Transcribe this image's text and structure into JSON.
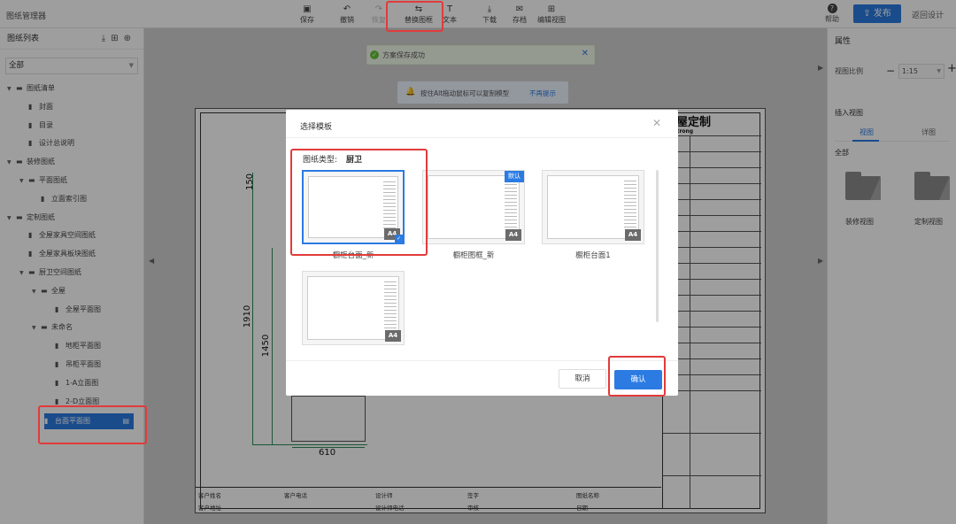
{
  "app": {
    "title": "图纸管理器"
  },
  "toolbar": {
    "items": [
      {
        "label": "保存",
        "icon": "save-icon"
      },
      {
        "label": "撤销",
        "icon": "undo-icon"
      },
      {
        "label": "恢复",
        "icon": "redo-icon"
      },
      {
        "label": "替换图框",
        "icon": "swap-icon"
      },
      {
        "label": "文本",
        "icon": "text-icon"
      },
      {
        "label": "下载",
        "icon": "download-icon"
      },
      {
        "label": "存档",
        "icon": "archive-icon"
      },
      {
        "label": "编辑视图",
        "icon": "edit-view-icon"
      }
    ],
    "help": "帮助",
    "publish": "发布",
    "back": "返回设计"
  },
  "left_panel": {
    "title": "图纸列表",
    "filter": "全部",
    "tree": [
      {
        "label": "图纸清单",
        "level": 0,
        "type": "group"
      },
      {
        "label": "封面",
        "level": 1,
        "type": "file"
      },
      {
        "label": "目录",
        "level": 1,
        "type": "file"
      },
      {
        "label": "设计总说明",
        "level": 1,
        "type": "file"
      },
      {
        "label": "装修图纸",
        "level": 0,
        "type": "group"
      },
      {
        "label": "平面图纸",
        "level": 1,
        "type": "group"
      },
      {
        "label": "立面索引图",
        "level": 2,
        "type": "file"
      },
      {
        "label": "定制图纸",
        "level": 0,
        "type": "group"
      },
      {
        "label": "全屋家具空间图纸",
        "level": 1,
        "type": "file"
      },
      {
        "label": "全屋家具板块图纸",
        "level": 1,
        "type": "file"
      },
      {
        "label": "厨卫空间图纸",
        "level": 1,
        "type": "group"
      },
      {
        "label": "全屋",
        "level": 2,
        "type": "group"
      },
      {
        "label": "全屋平面图",
        "level": 3,
        "type": "file"
      },
      {
        "label": "未命名",
        "level": 2,
        "type": "group"
      },
      {
        "label": "地柜平面图",
        "level": 3,
        "type": "file"
      },
      {
        "label": "吊柜平面图",
        "level": 3,
        "type": "file"
      },
      {
        "label": "1-A立面图",
        "level": 3,
        "type": "file"
      },
      {
        "label": "2-D立面图",
        "level": 3,
        "type": "file"
      },
      {
        "label": "台面平面图",
        "level": 2,
        "type": "file",
        "selected": true
      }
    ]
  },
  "right_panel": {
    "title": "属性",
    "scale_label": "视图比例",
    "scale_value": "1:15",
    "insert_title": "插入视图",
    "tabs": [
      "视图",
      "详图"
    ],
    "filter": "全部",
    "folders": [
      "装修视图",
      "定制视图"
    ]
  },
  "notifications": {
    "toast": "方案保存成功",
    "hint": "按住Alt拖动鼠标可以复制模型",
    "hint_link": "不再提示"
  },
  "drawing": {
    "dims": [
      "150",
      "1910",
      "1450",
      "610"
    ],
    "logo": "全屋定制",
    "logo_sub": "strong",
    "bottom_table": [
      "客户姓名",
      "客户电话",
      "设计师",
      "签字",
      "图纸名称",
      "客户地址",
      "设计师电话",
      "审核",
      "日期"
    ]
  },
  "modal": {
    "title": "选择模板",
    "drawing_type_label": "图纸类型:",
    "drawing_type_value": "厨卫",
    "templates": [
      {
        "name": "橱柜台面_新",
        "badge": "A4",
        "selected": true,
        "default": false
      },
      {
        "name": "橱柜图框_新",
        "badge": "A4",
        "selected": false,
        "default": true,
        "default_label": "默认"
      },
      {
        "name": "橱柜台面1",
        "badge": "A4",
        "selected": false,
        "default": false
      },
      {
        "name": "",
        "badge": "A4",
        "selected": false,
        "default": false
      }
    ],
    "cancel": "取消",
    "confirm": "确认"
  },
  "colors": {
    "accent": "#2b7be3",
    "highlight": "#e23b3b",
    "success": "#67c23a"
  }
}
